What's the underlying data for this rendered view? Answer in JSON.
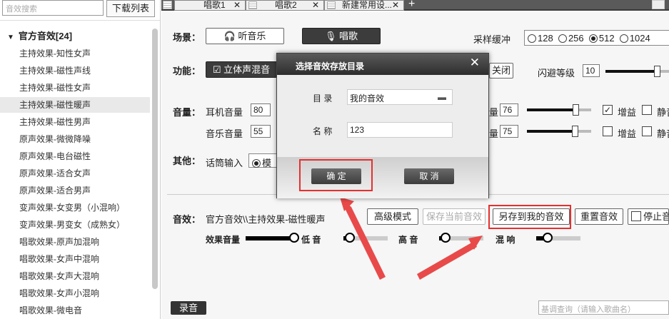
{
  "left_panel": {
    "search_placeholder": "音效搜索",
    "download_list": "下载列表",
    "group_label": "官方音效[24]",
    "items": [
      "主持效果-知性女声",
      "主持效果-磁性声线",
      "主持效果-磁性女声",
      "主持效果-磁性暖声",
      "主持效果-磁性男声",
      "原声效果-微微降噪",
      "原声效果-电台磁性",
      "原声效果-适合女声",
      "原声效果-适合男声",
      "变声效果-女变男（小混响）",
      "变声效果-男变女（成熟女）",
      "唱歌效果-原声加混响",
      "唱歌效果-女声中混响",
      "唱歌效果-女声大混响",
      "唱歌效果-女声小混响",
      "唱歌效果-微电音"
    ],
    "selected_index": 3
  },
  "tabs": [
    {
      "label": "唱歌1",
      "close": "✕"
    },
    {
      "label": "唱歌2",
      "close": "✕"
    },
    {
      "label": "新建常用设...",
      "close": "✕"
    }
  ],
  "tab_add": "+",
  "scene": {
    "label": "场景：",
    "listen": "🎧 听音乐",
    "sing": "🎙 唱歌"
  },
  "sample_buffer": {
    "label": "采样缓冲",
    "options": [
      "128",
      "256",
      "512",
      "1024"
    ],
    "selected": "512"
  },
  "function": {
    "label": "功能：",
    "stereo": "☑ 立体声混音",
    "off": "关闭",
    "duck_label": "闪避等级",
    "duck_value": "10",
    "duck_level": 0.8
  },
  "volume": {
    "label": "音量：",
    "headphone_label": "耳机音量",
    "headphone_value": "80",
    "music_label": "音乐音量",
    "music_value": "55",
    "right1_suffix": "量",
    "right1_value": "76",
    "right1_level": 0.76,
    "right2_suffix": "量",
    "right2_value": "75",
    "right2_level": 0.75,
    "gain": "增益",
    "mute": "静音",
    "gain1_checked": "✓"
  },
  "other": {
    "label": "其他：",
    "mic_label": "话筒输入",
    "mode": "模"
  },
  "effect": {
    "label": "音效：",
    "path": "官方音效\\\\主持效果-磁性暖声",
    "advanced": "高级模式",
    "save_current": "保存当前音效",
    "save_to_mine": "另存到我的音效",
    "reset": "重置音效",
    "stop": "停止音效",
    "effect_vol": "效果音量",
    "bass": "低 音",
    "treble": "高 音",
    "reverb": "混 响",
    "effect_vol_level": 1.0,
    "bass_level": 0.15,
    "treble_level": 0.15,
    "reverb_level": 0.25
  },
  "record": "录音",
  "song_search_placeholder": "基调查询（请输入歌曲名）",
  "dialog": {
    "title": "选择音效存放目录",
    "close": "✕",
    "dir_label": "目 录",
    "dir_value": "我的音效",
    "name_label": "名 称",
    "name_value": "123",
    "ok": "确 定",
    "cancel": "取 消"
  }
}
